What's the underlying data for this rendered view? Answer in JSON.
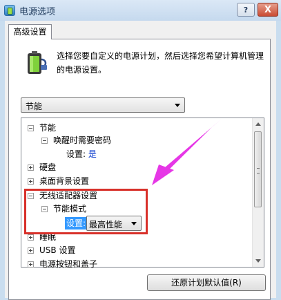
{
  "window": {
    "title": "电源选项",
    "help_label": "?",
    "close_label": "X"
  },
  "tab": {
    "label": "高级设置"
  },
  "description": "选择您要自定义的电源计划，然后选择您希望计算机管理的电源设置。",
  "plan_select": {
    "value": "节能"
  },
  "tree": [
    {
      "label": "节能",
      "expanded": true
    },
    {
      "label": "唤醒时需要密码",
      "expanded": true
    },
    {
      "setting_label": "设置:",
      "setting_value": "是"
    },
    {
      "label": "硬盘",
      "expanded": false
    },
    {
      "label": "桌面背景设置",
      "expanded": false
    },
    {
      "label": "无线适配器设置",
      "expanded": true
    },
    {
      "label": "节能模式",
      "expanded": true
    },
    {
      "setting_label": "设置:",
      "setting_value": "最高性能"
    },
    {
      "label": "睡眠",
      "expanded": false
    },
    {
      "label": "USB 设置",
      "expanded": false
    },
    {
      "label": "电源按钮和盖子",
      "expanded": false
    }
  ],
  "restore_button": "还原计划默认值(R)",
  "colors": {
    "highlight_box": "#d8302a",
    "annotation_arrow": "#e637e6",
    "selection": "#3399ff",
    "setting_value": "#0033cc"
  }
}
